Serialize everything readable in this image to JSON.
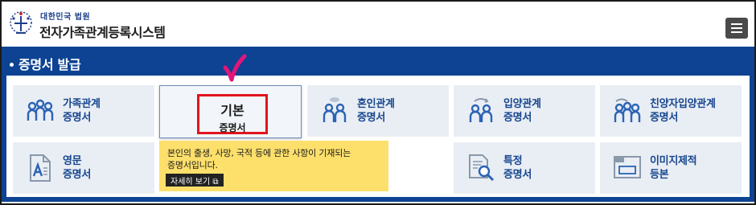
{
  "header": {
    "org_subtitle": "대한민국 법원",
    "site_title": "전자가족관계등록시스템"
  },
  "section": {
    "title": "증명서 발급"
  },
  "tiles": [
    {
      "line1": "가족관계",
      "line2": "증명서",
      "icon": "family-people-icon"
    },
    {
      "line1": "혼인관계",
      "line2": "증명서",
      "icon": "couple-icon"
    },
    {
      "line1": "입양관계",
      "line2": "증명서",
      "icon": "adoption-icon"
    },
    {
      "line1": "친양자입양관계",
      "line2": "증명서",
      "icon": "adoption-family-icon"
    },
    {
      "line1": "영문",
      "line2": "증명서",
      "icon": "english-document-icon"
    },
    {
      "line1": "특정",
      "line2": "증명서",
      "icon": "search-document-icon"
    },
    {
      "line1": "이미지제적",
      "line2": "등본",
      "icon": "image-register-icon"
    }
  ],
  "basic": {
    "line1": "기본",
    "line2": "증명서"
  },
  "tooltip": {
    "text_line1": "본인의 출생, 사망, 국적 등에 관한 사항이 기재되는",
    "text_line2": "증명서입니다.",
    "more_label": "자세히 보기"
  },
  "colors": {
    "panel_blue": "#0d4392",
    "tile_bg": "#e9eef4",
    "label_blue": "#17468f",
    "highlight_red": "#e2141c",
    "tooltip_yellow": "#fde06c",
    "check_magenta": "#e3157a"
  }
}
